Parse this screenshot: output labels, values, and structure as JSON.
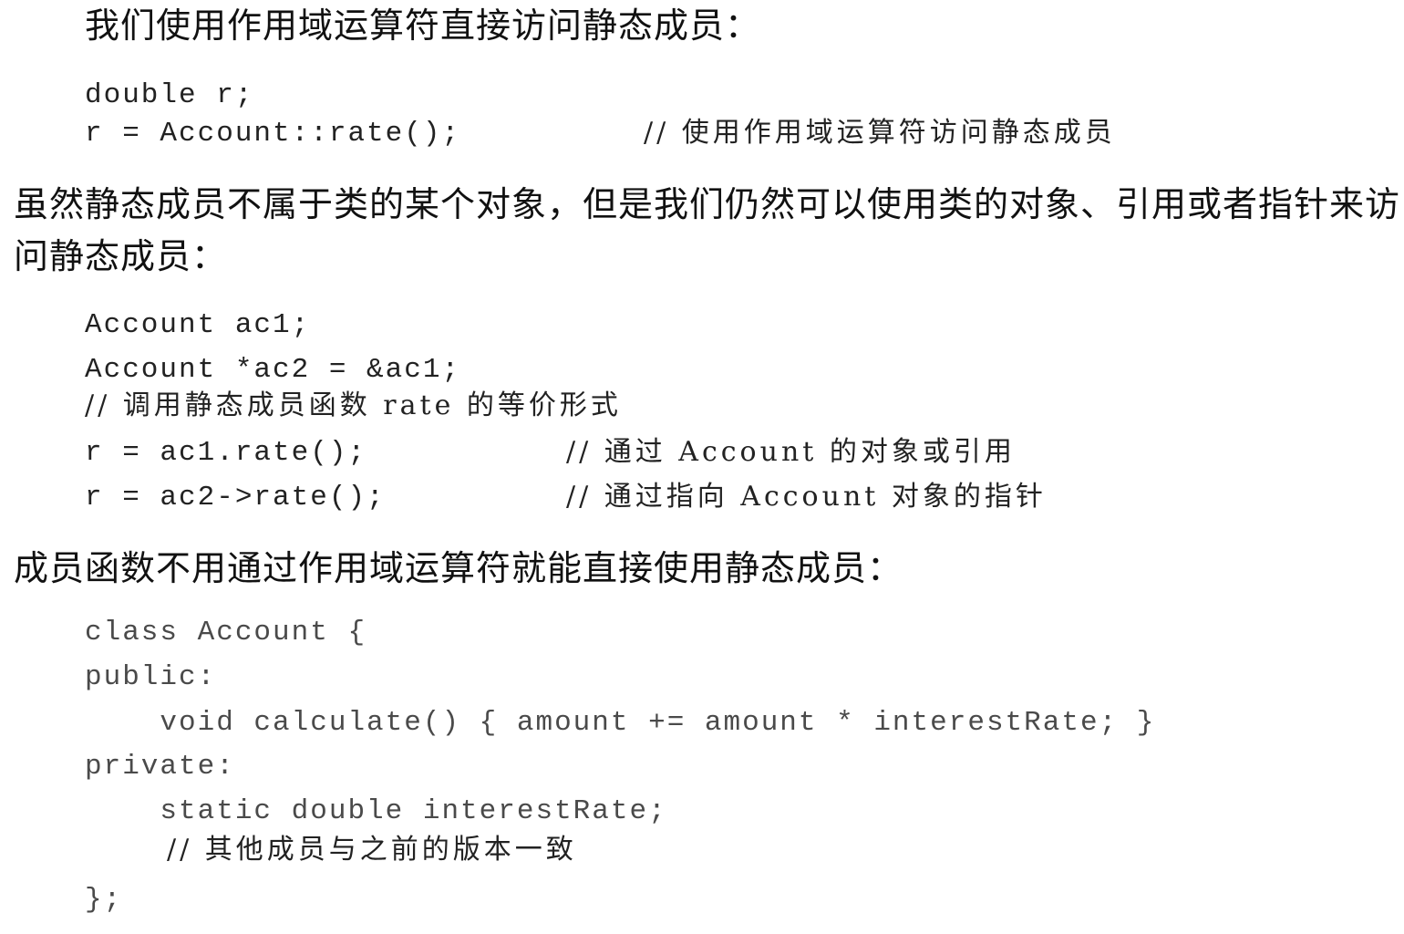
{
  "section1": {
    "intro": "我们使用作用域运算符直接访问静态成员：",
    "code_line1": "double r;",
    "code_line2": "r = Account::rate();",
    "code_line2_comment": "// 使用作用域运算符访问静态成员"
  },
  "section2": {
    "para_line1": "虽然静态成员不属于类的某个对象，但是我们仍然可以使用类的对象、引用或者指针来访",
    "para_line2": "问静态成员：",
    "code_line1": "Account ac1;",
    "code_line2": "Account *ac2 = &ac1;",
    "code_comment": "// 调用静态成员函数 rate 的等价形式",
    "code_line3": "r = ac1.rate();",
    "code_line3_comment": "// 通过 Account 的对象或引用",
    "code_line4": "r = ac2->rate();",
    "code_line4_comment": "// 通过指向 Account 对象的指针"
  },
  "section3": {
    "intro": "成员函数不用通过作用域运算符就能直接使用静态成员：",
    "code_line1": "class Account {",
    "code_line2": "public:",
    "code_line3": "    void calculate() { amount += amount * interestRate; }",
    "code_line4": "private:",
    "code_line5": "    static double interestRate;",
    "code_comment": "// 其他成员与之前的版本一致",
    "code_line6": "};"
  }
}
